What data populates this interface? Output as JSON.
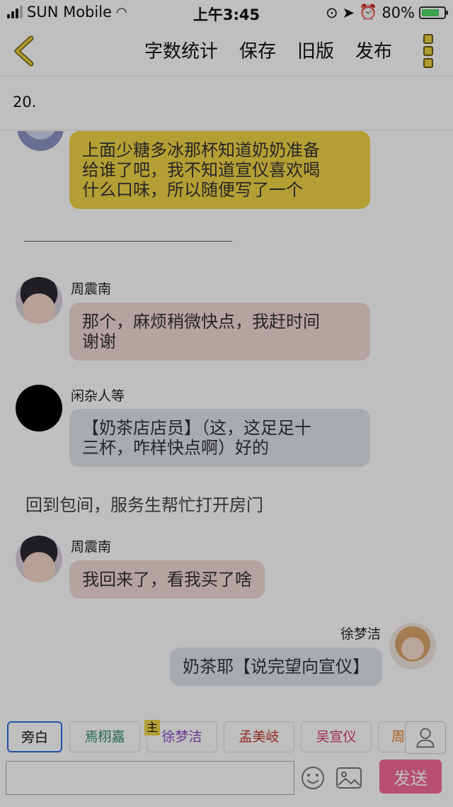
{
  "status_bar": {
    "carrier": "SUN Mobile",
    "time": "上午3:45",
    "battery": "80%",
    "battery_level": 0.8
  },
  "nav": {
    "items": [
      {
        "label": "字数统计"
      },
      {
        "label": "保存"
      },
      {
        "label": "旧版"
      },
      {
        "label": "发布"
      }
    ],
    "icons": {
      "back": "chevron-left-icon",
      "more": "vertical-dots-icon"
    }
  },
  "title": "20.",
  "messages": [
    {
      "speaker": "",
      "text_lines": [
        "上面少糖多冰那杯知道奶奶准备",
        "给谁了吧，我不知道宣仪喜欢喝",
        "什么口味，所以随便写了一个"
      ],
      "color": "#f1d447"
    },
    {
      "speaker": "周震南",
      "text_lines": [
        "那个，麻烦稍微快点，我赶时间",
        "谢谢"
      ],
      "color": "#f5d8d8"
    },
    {
      "speaker": "闲杂人等",
      "text_lines": [
        "【奶茶店店员】（这，这足足十",
        "三杯，咋样快点啊）好的"
      ],
      "color": "#dfe4ea"
    },
    {
      "speaker": "周震南",
      "text_lines": [
        "我回来了，看我买了啥"
      ],
      "color": "#f5d8d8"
    },
    {
      "speaker": "徐梦洁",
      "text_lines": [
        "奶茶耶【说完望向宣仪】"
      ],
      "color": "#dfe4ea"
    }
  ],
  "narration": "回到包间，服务生帮忙打开房门",
  "roles": [
    {
      "label": "旁白",
      "color": "#111111"
    },
    {
      "label": "焉栩嘉",
      "color": "#2e8b6e"
    },
    {
      "label": "徐梦洁",
      "color": "#8a4fc4"
    },
    {
      "label": "孟美岐",
      "color": "#c0392b"
    },
    {
      "label": "吴宣仪",
      "color": "#d63a6e"
    },
    {
      "label": "周",
      "color": "#e67e22"
    }
  ],
  "host_badge": "主",
  "input": {
    "placeholder": "",
    "send_label": "发送"
  },
  "colors": {
    "send": "#f56a9b",
    "active_role_border": "#2f6fe0"
  }
}
